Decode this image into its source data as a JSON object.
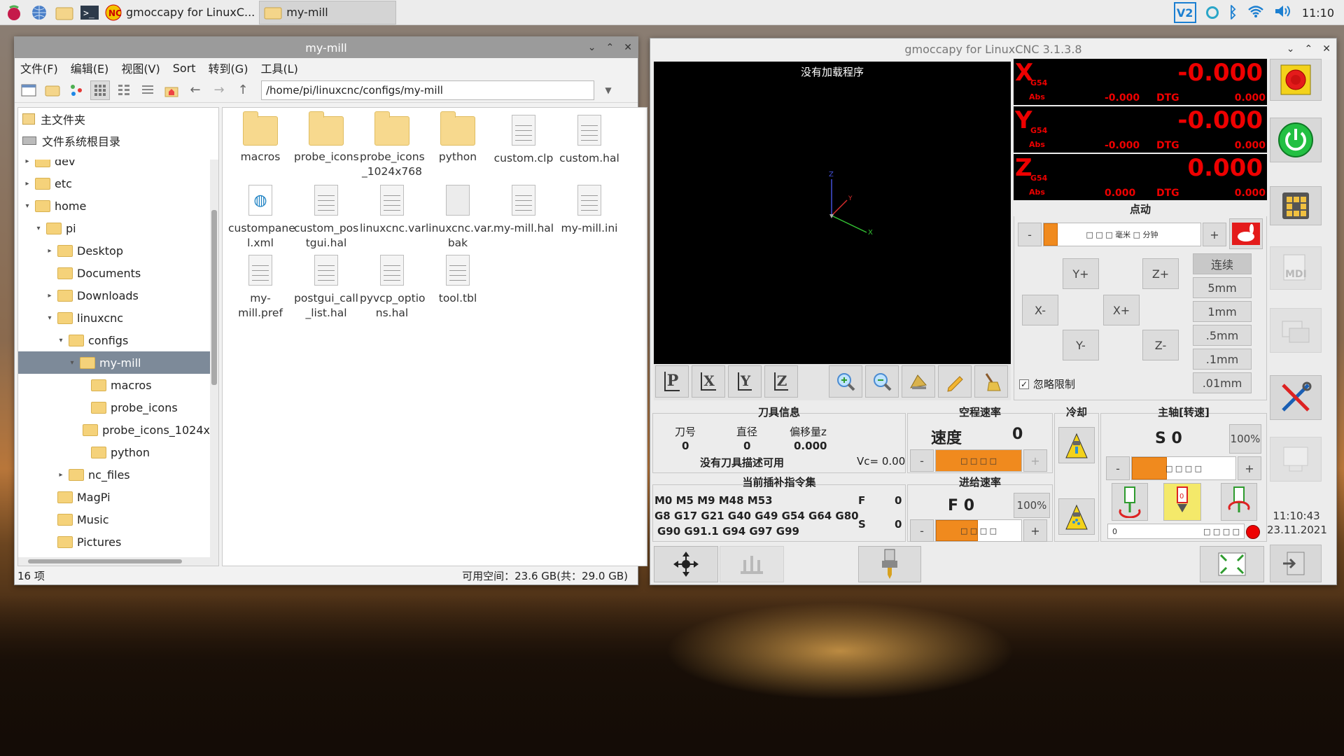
{
  "taskbar": {
    "tasks": [
      {
        "label": "gmoccapy for LinuxC..."
      },
      {
        "label": "my-mill"
      }
    ],
    "clock": "11:10"
  },
  "filemanager": {
    "title": "my-mill",
    "menu": [
      "文件(F)",
      "编辑(E)",
      "视图(V)",
      "Sort",
      "转到(G)",
      "工具(L)"
    ],
    "path": "/home/pi/linuxcnc/configs/my-mill",
    "places": [
      "主文件夹",
      "文件系统根目录"
    ],
    "tree": [
      {
        "label": "dev",
        "indent": 1,
        "arrow": "▸"
      },
      {
        "label": "etc",
        "indent": 1,
        "arrow": "▸"
      },
      {
        "label": "home",
        "indent": 1,
        "arrow": "▾"
      },
      {
        "label": "pi",
        "indent": 2,
        "arrow": "▾"
      },
      {
        "label": "Desktop",
        "indent": 3,
        "arrow": "▸"
      },
      {
        "label": "Documents",
        "indent": 3,
        "arrow": ""
      },
      {
        "label": "Downloads",
        "indent": 3,
        "arrow": "▸"
      },
      {
        "label": "linuxcnc",
        "indent": 3,
        "arrow": "▾"
      },
      {
        "label": "configs",
        "indent": 4,
        "arrow": "▾"
      },
      {
        "label": "my-mill",
        "indent": 5,
        "arrow": "▾",
        "selected": true
      },
      {
        "label": "macros",
        "indent": 6,
        "arrow": ""
      },
      {
        "label": "probe_icons",
        "indent": 6,
        "arrow": ""
      },
      {
        "label": "probe_icons_1024x",
        "indent": 6,
        "arrow": ""
      },
      {
        "label": "python",
        "indent": 6,
        "arrow": ""
      },
      {
        "label": "nc_files",
        "indent": 4,
        "arrow": "▸"
      },
      {
        "label": "MagPi",
        "indent": 3,
        "arrow": ""
      },
      {
        "label": "Music",
        "indent": 3,
        "arrow": ""
      },
      {
        "label": "Pictures",
        "indent": 3,
        "arrow": ""
      }
    ],
    "files": [
      {
        "name": "macros",
        "kind": "folder"
      },
      {
        "name": "probe_icons",
        "kind": "folder"
      },
      {
        "name": "probe_icons\n_1024x768",
        "kind": "folder"
      },
      {
        "name": "python",
        "kind": "folder"
      },
      {
        "name": "custom.clp",
        "kind": "doc"
      },
      {
        "name": "custom.hal",
        "kind": "doc"
      },
      {
        "name": "custompane\nl.xml",
        "kind": "xml"
      },
      {
        "name": "custom_pos\ntgui.hal",
        "kind": "doc"
      },
      {
        "name": "linuxcnc.var",
        "kind": "doc"
      },
      {
        "name": "linuxcnc.var.\nbak",
        "kind": "blank"
      },
      {
        "name": "my-mill.hal",
        "kind": "doc"
      },
      {
        "name": "my-mill.ini",
        "kind": "doc"
      },
      {
        "name": "my-mill.pref",
        "kind": "doc"
      },
      {
        "name": "postgui_call\n_list.hal",
        "kind": "doc"
      },
      {
        "name": "pyvcp_optio\nns.hal",
        "kind": "doc"
      },
      {
        "name": "tool.tbl",
        "kind": "doc"
      }
    ],
    "status_count": "16 项",
    "status_space": "可用空间：23.6 GB(共：29.0 GB)"
  },
  "gmoccapy": {
    "title": "gmoccapy for LinuxCNC  3.1.3.8",
    "no_program": "没有加载程序",
    "dro": [
      {
        "axis": "X",
        "coord": "G54",
        "abs_label": "Abs",
        "value": "-0.000",
        "abs": "-0.000",
        "dtg_label": "DTG",
        "dtg": "0.000"
      },
      {
        "axis": "Y",
        "coord": "G54",
        "abs_label": "Abs",
        "value": "-0.000",
        "abs": "-0.000",
        "dtg_label": "DTG",
        "dtg": "0.000"
      },
      {
        "axis": "Z",
        "coord": "G54",
        "abs_label": "Abs",
        "value": "0.000",
        "abs": "0.000",
        "dtg_label": "DTG",
        "dtg": "0.000"
      }
    ],
    "jog": {
      "header": "点动",
      "minus": "-",
      "plus": "+",
      "speed_text": "□ □ □ 毫米 □ 分钟",
      "buttons": {
        "yplus": "Y+",
        "yminus": "Y-",
        "xminus": "X-",
        "xplus": "X+",
        "zplus": "Z+",
        "zminus": "Z-"
      },
      "increments": [
        "连续",
        "5mm",
        "1mm",
        ".5mm",
        ".1mm",
        ".01mm"
      ],
      "ignore_limits": "忽略限制"
    },
    "tool": {
      "header": "刀具信息",
      "col1": "刀号",
      "col2": "直径",
      "col3": "偏移量z",
      "v1": "0",
      "v2": "0",
      "v3": "0.000",
      "desc": "没有刀具描述可用",
      "vc": "Vc= 0.00"
    },
    "rapid": {
      "header": "空程速率",
      "label": "速度",
      "value": "0",
      "minus": "-",
      "plus": "+",
      "slider": "□ □ □ □"
    },
    "gcodes": {
      "header": "当前插补指令集",
      "line1": "M0 M5 M9 M48 M53",
      "line2": "G8 G17 G21 G40 G49 G54 G64 G80",
      "line3": "G90 G91.1 G94 G97 G99",
      "f_label": "F",
      "f_val": "0",
      "s_label": "S",
      "s_val": "0"
    },
    "feed": {
      "header": "进给速率",
      "label": "F 0",
      "pct": "100%",
      "minus": "-",
      "plus": "+",
      "slider": "□ □ □ □"
    },
    "coolant": {
      "header": "冷却"
    },
    "spindle": {
      "header": "主轴[转速]",
      "label": "S 0",
      "pct": "100%",
      "minus": "-",
      "plus": "+",
      "slider": "□ □ □ □",
      "bar": "□ □ □ □",
      "bar_left": "0"
    },
    "clock_time": "11:10:43",
    "clock_date": "23.11.2021",
    "view_buttons": [
      "P",
      "X",
      "Y",
      "Z"
    ]
  }
}
